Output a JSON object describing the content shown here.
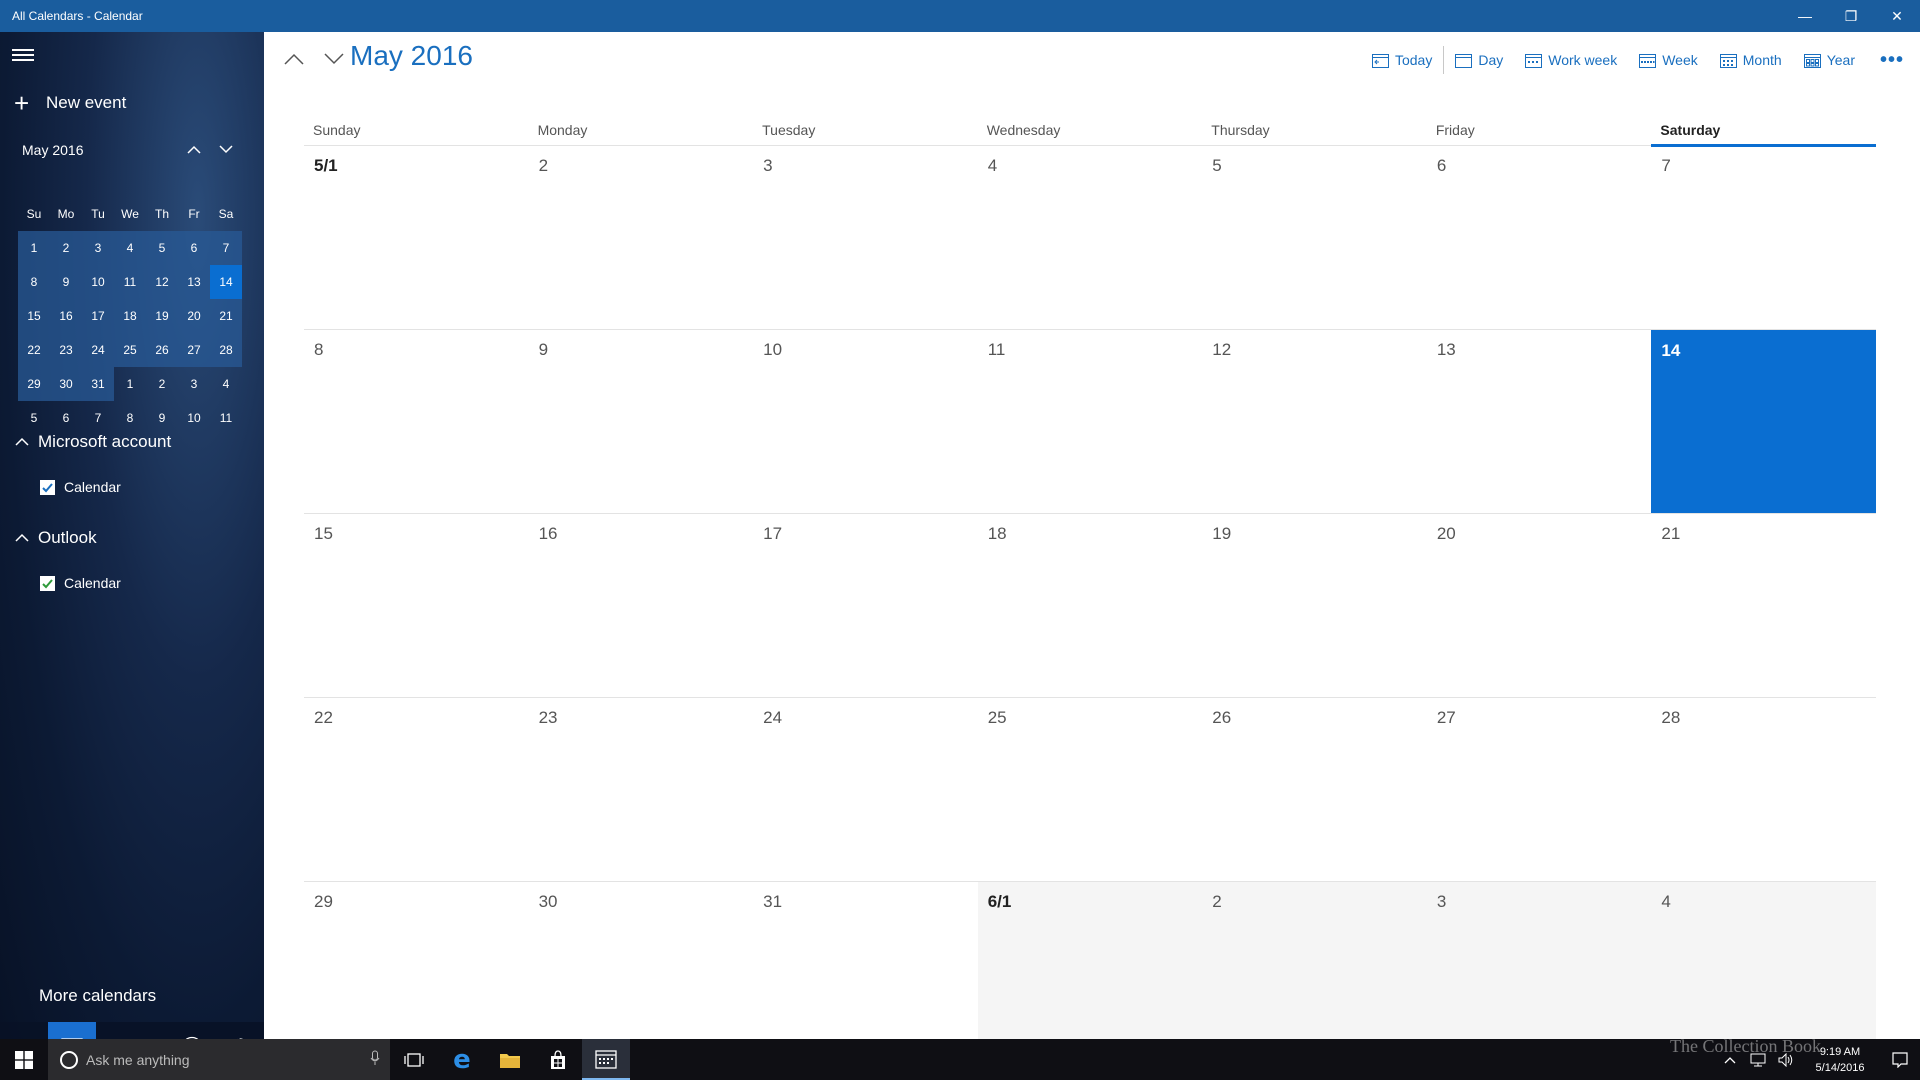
{
  "window": {
    "title": "All Calendars - Calendar"
  },
  "sidebar": {
    "new_event": "New event",
    "mini_cal": {
      "title": "May 2016",
      "dow": [
        "Su",
        "Mo",
        "Tu",
        "We",
        "Th",
        "Fr",
        "Sa"
      ],
      "days": [
        "1",
        "2",
        "3",
        "4",
        "5",
        "6",
        "7",
        "8",
        "9",
        "10",
        "11",
        "12",
        "13",
        "14",
        "15",
        "16",
        "17",
        "18",
        "19",
        "20",
        "21",
        "22",
        "23",
        "24",
        "25",
        "26",
        "27",
        "28",
        "29",
        "30",
        "31",
        "1",
        "2",
        "3",
        "4",
        "5",
        "6",
        "7",
        "8",
        "9",
        "10",
        "11"
      ],
      "selected": "14"
    },
    "accounts": [
      {
        "name": "Microsoft account",
        "calendar": "Calendar",
        "check_color": "#1a6fbf"
      },
      {
        "name": "Outlook",
        "calendar": "Calendar",
        "check_color": "#2f9a3a"
      }
    ],
    "more_calendars": "More calendars"
  },
  "main": {
    "title": "May 2016",
    "toolbar": {
      "today": "Today",
      "day": "Day",
      "work_week": "Work week",
      "week": "Week",
      "month": "Month",
      "year": "Year",
      "more": "•••"
    },
    "weekdays": [
      "Sunday",
      "Monday",
      "Tuesday",
      "Wednesday",
      "Thursday",
      "Friday",
      "Saturday"
    ],
    "today_weekday": "Saturday",
    "days": [
      "5/1",
      "2",
      "3",
      "4",
      "5",
      "6",
      "7",
      "8",
      "9",
      "10",
      "11",
      "12",
      "13",
      "14",
      "15",
      "16",
      "17",
      "18",
      "19",
      "20",
      "21",
      "22",
      "23",
      "24",
      "25",
      "26",
      "27",
      "28",
      "29",
      "30",
      "31",
      "6/1",
      "2",
      "3",
      "4"
    ],
    "selected_day": "14"
  },
  "taskbar": {
    "search_placeholder": "Ask me anything",
    "time": "9:19 AM",
    "date": "5/14/2016"
  },
  "watermark": "The Collection Book",
  "colors": {
    "accent": "#0a6ed1",
    "title_bar": "#1a5d9e"
  }
}
